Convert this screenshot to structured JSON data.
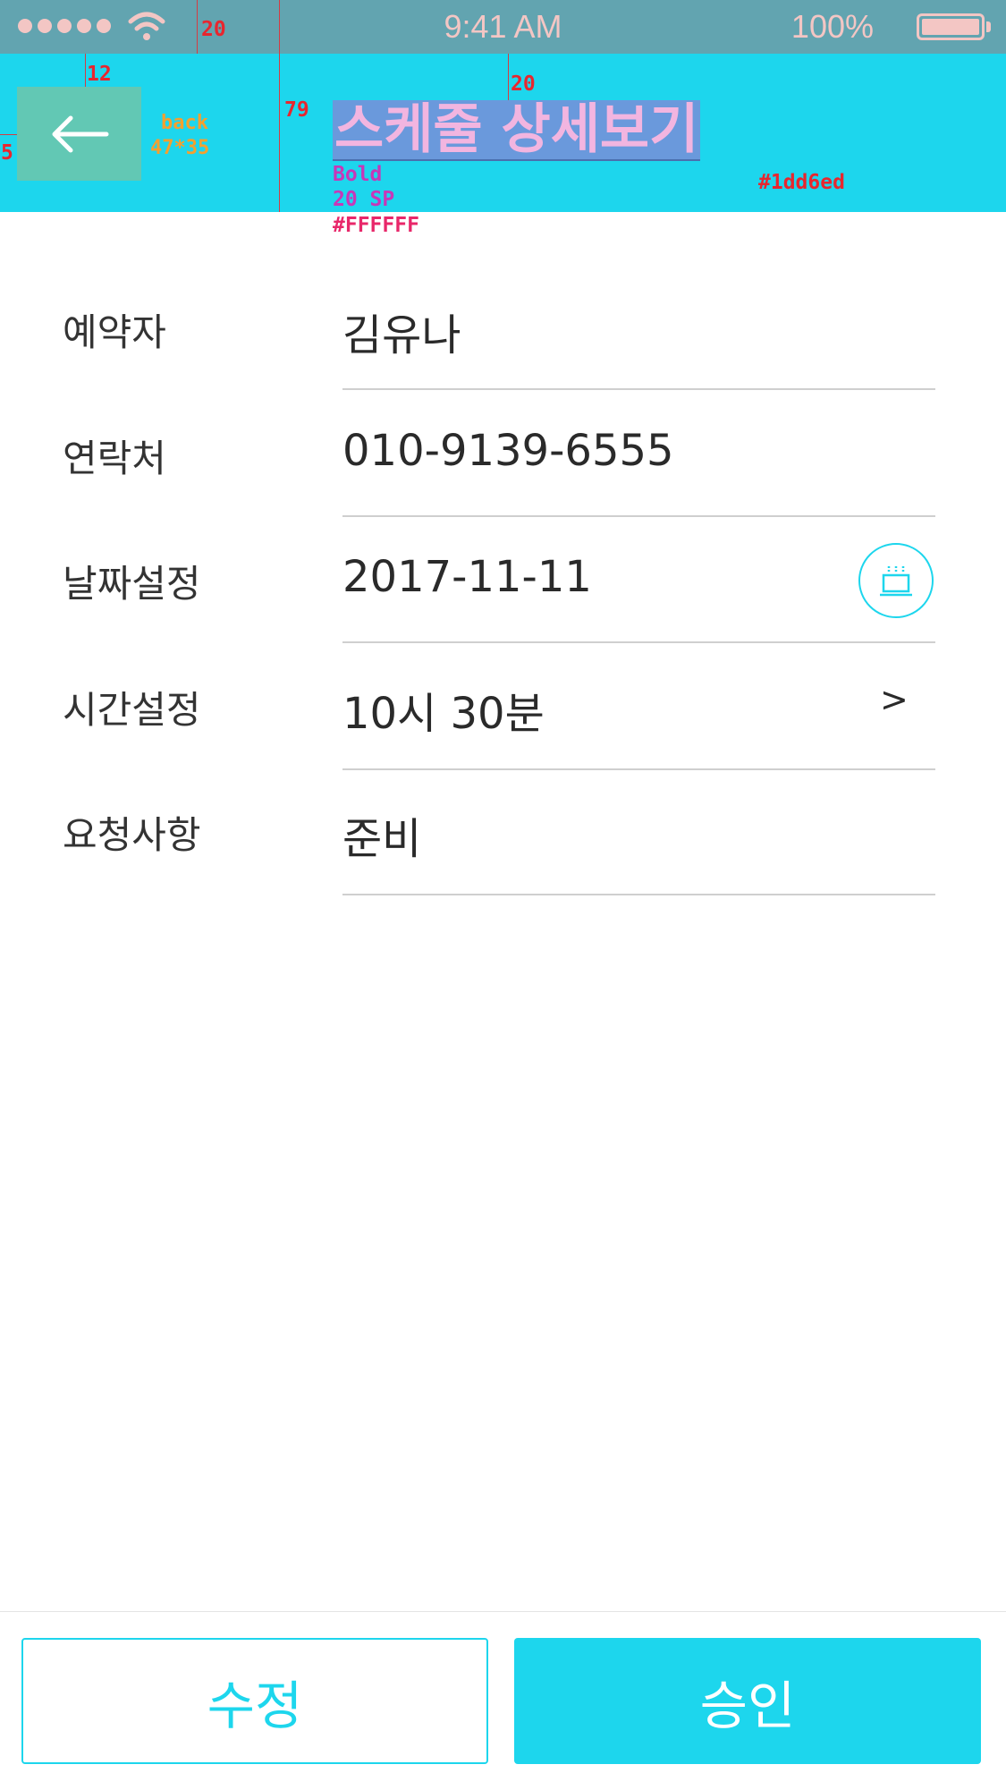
{
  "status_bar": {
    "time": "9:41 AM",
    "battery_percent": "100%",
    "battery_level": 1.0,
    "signal_icon": "signal-dots-icon",
    "wifi_icon": "wifi-icon",
    "battery_icon": "battery-icon"
  },
  "header": {
    "title": "스케줄 상세보기",
    "back_icon": "arrow-left-icon",
    "background_color": "#1dd6ed"
  },
  "annotations": {
    "statusbar_height": "20",
    "back_top_margin": "12",
    "back_left_margin": "5",
    "title_left": "79",
    "title_top": "20",
    "back_label": "back",
    "back_size": "47*35",
    "title_weight": "Bold",
    "title_size": "20 SP",
    "title_color": "#FFFFFF",
    "header_color": "#1dd6ed"
  },
  "form": {
    "fields": [
      {
        "label": "예약자",
        "value": "김유나"
      },
      {
        "label": "연락처",
        "value": "010-9139-6555"
      },
      {
        "label": "날짜설정",
        "value": "2017-11-11",
        "icon": "calendar-cake-icon"
      },
      {
        "label": "시간설정",
        "value": "10시 30분",
        "chevron": ">"
      },
      {
        "label": "요청사항",
        "value": "준비"
      }
    ]
  },
  "footer": {
    "edit_label": "수정",
    "approve_label": "승인"
  },
  "colors": {
    "accent": "#1dd6ed",
    "text": "#2a2a2a",
    "divider": "#cfcfcf"
  }
}
